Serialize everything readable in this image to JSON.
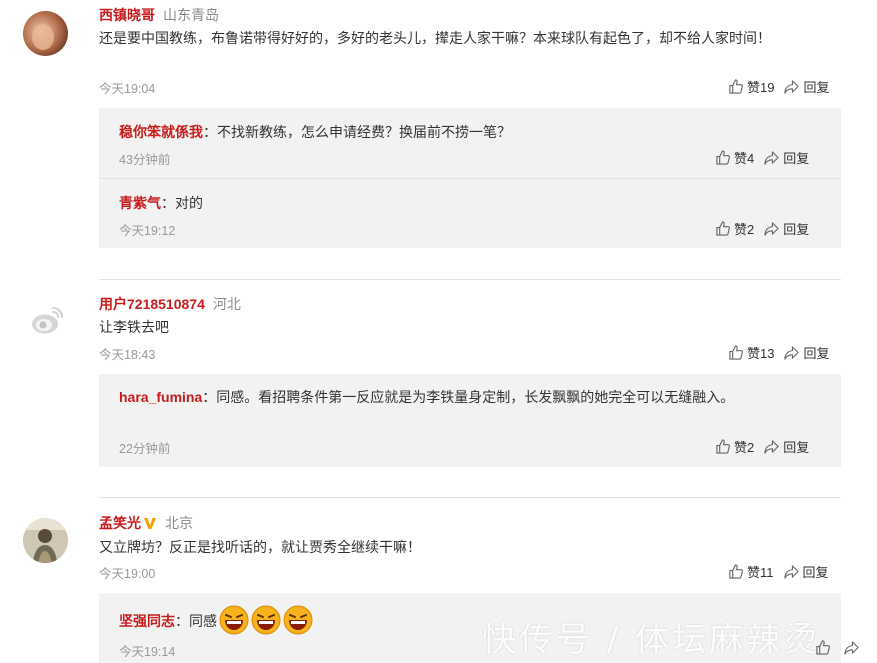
{
  "comments": [
    {
      "user": "西镇晓哥",
      "location": "山东青岛",
      "text": "还是要中国教练，布鲁诺带得好好的，多好的老头儿，撵走人家干嘛？本来球队有起色了，却不给人家时间！",
      "time": "今天19:04",
      "likes": "赞19",
      "reply": "回复",
      "replies": [
        {
          "user": "稳你笨就係我",
          "text": "不找新教练，怎么申请经费？换届前不捞一笔？",
          "time": "43分钟前",
          "likes": "赞4",
          "reply": "回复"
        },
        {
          "user": "青紫气",
          "text": "对的",
          "time": "今天19:12",
          "likes": "赞2",
          "reply": "回复"
        }
      ]
    },
    {
      "user": "用户7218510874",
      "location": "河北",
      "text": "让李铁去吧",
      "time": "今天18:43",
      "likes": "赞13",
      "reply": "回复",
      "replies": [
        {
          "user": "hara_fumina",
          "text": "同感。看招聘条件第一反应就是为李铁量身定制，长发飘飘的她完全可以无缝融入。",
          "time": "22分钟前",
          "likes": "赞2",
          "reply": "回复"
        }
      ]
    },
    {
      "user": "孟笑光",
      "location": "北京",
      "text": "又立牌坊？反正是找听话的，就让贾秀全继续干嘛！",
      "time": "今天19:00",
      "likes": "赞11",
      "reply": "回复",
      "replies": [
        {
          "user": "坚强同志",
          "text": "同感",
          "time": "今天19:14",
          "likes": "",
          "reply": ""
        }
      ]
    }
  ],
  "watermark": "快传号 / 体坛麻辣烫",
  "colors": {
    "username": "#c81c1c",
    "reply_bg": "#f2f2f2",
    "vip_badge": "#f4a000"
  }
}
